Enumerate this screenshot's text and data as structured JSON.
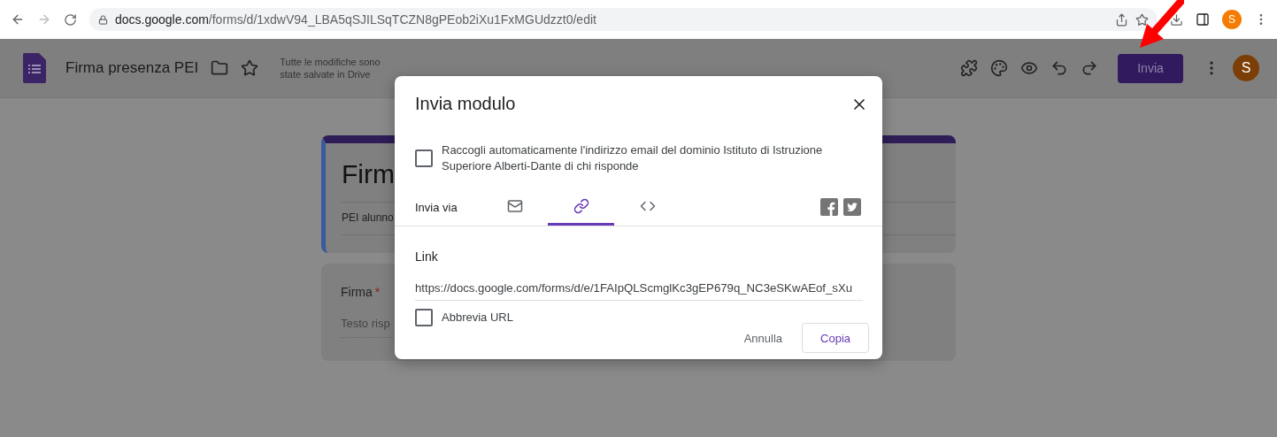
{
  "browser": {
    "url_host": "docs.google.com",
    "url_path": "/forms/d/1xdwV94_LBA5qSJILSqTCZN8gPEob2iXu1FxMGUdzzt0/edit",
    "profile_initial": "S"
  },
  "header": {
    "title": "Firma presenza PEI",
    "save_status": "Tutte le modifiche sono state salvate in Drive",
    "send_button": "Invia",
    "avatar_initial": "S"
  },
  "form": {
    "title": "Firm",
    "description": "PEI alunno",
    "question": {
      "label": "Firma",
      "required_mark": "*",
      "placeholder": "Testo risp"
    }
  },
  "dialog": {
    "title": "Invia modulo",
    "collect_email": {
      "label": "Raccogli automaticamente l'indirizzo email del dominio Istituto di Istruzione Superiore Alberti-Dante di chi risponde",
      "checked": false
    },
    "send_via_label": "Invia via",
    "tabs": [
      {
        "kind": "email",
        "selected": false
      },
      {
        "kind": "link",
        "selected": true
      },
      {
        "kind": "embed",
        "selected": false
      }
    ],
    "link_label": "Link",
    "link_value": "https://docs.google.com/forms/d/e/1FAIpQLScmglKc3gEP679q_NC3eSKwAEof_sXu",
    "shorten": {
      "label": "Abbrevia URL",
      "checked": false
    },
    "buttons": [
      {
        "kind": "text",
        "label": "Annulla"
      },
      {
        "kind": "outlined",
        "label": "Copia"
      }
    ]
  }
}
